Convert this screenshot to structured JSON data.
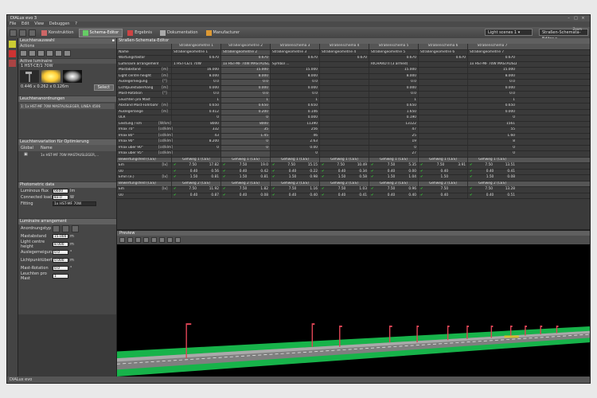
{
  "window": {
    "title": "DIALux evo 3",
    "buttons": [
      "–",
      "□",
      "×"
    ]
  },
  "menu": [
    "File",
    "Edit",
    "View",
    "Debuggen",
    "?"
  ],
  "tabs": [
    {
      "label": "Konstruktion"
    },
    {
      "label": "Schema-Editor",
      "active": true
    },
    {
      "label": "Ergebnis"
    },
    {
      "label": "Dokumentation"
    },
    {
      "label": "Manufacturer"
    }
  ],
  "toolbar": {
    "scene": "Light scenes 1",
    "editor": "Straßen-Schemata-Editor",
    "zoom": "Zoom"
  },
  "left": {
    "header": "Leuchtenauswahl",
    "actions": "Actions",
    "active": "Active luminaire",
    "lum_name": "1 HST-CE/1 70W",
    "dims": "0.446 x 0.262 x 0.126m",
    "select": "Select",
    "groups_header": "Leuchtenanordnungen",
    "group_item": "1: 1x HST-MF 70W MASTAUSLEGER, LINEA 4506",
    "opt_header": "Leuchtenvariation für Optimierung",
    "opt_cols": [
      "Global",
      "Name"
    ],
    "opt_row": "1x HST-MF 70W MASTAUSLEGER,...",
    "photo_header": "Photometric data",
    "flux_label": "Luminous flux",
    "flux": "6600",
    "flux_unit": "lm",
    "load_label": "Connected load",
    "load": "83.0",
    "load_unit": "W",
    "fitting_label": "Fitting",
    "fitting": "1x HST-MF 70W",
    "arr_header": "Luminaire arrangement",
    "arr_type": "Anordnungstyp",
    "mast_label": "Mastabstand",
    "mast": "15.000",
    "light_h_label": "Light centre height",
    "light_h": "8.000",
    "overhang_label": "Auslegerneigung",
    "overhang": "0.0",
    "lps_label": "Lichtpunktüberhang",
    "lps": "0.000",
    "rot_label": "Mast-Rotation",
    "rot": "0.0",
    "per_label": "Leuchten pro Mast",
    "per": "1"
  },
  "editor": {
    "header": "Straßen-Schemata-Editor",
    "status": "DIALux evo"
  },
  "grid": {
    "columns": [
      "Straßengeometrie 1",
      "Straßengeometrie 2",
      "Straßenschema 3",
      "Straßenschema 4",
      "Straßenschema 5",
      "Straßenschema 6",
      "Straßenschema 7"
    ],
    "rows": [
      {
        "n": "Name",
        "u": "",
        "v": [
          "Straßengeometrie 1",
          "Straßengeometrie 2",
          "Straßengeometrie 3",
          "Straßengeometrie 4",
          "Straßengeometrie 5",
          "Straßengeometrie 6",
          "Straßengeometrie 7"
        ],
        "left": true
      },
      {
        "n": "Wartungsfaktor",
        "u": "",
        "v": [
          "0.670",
          "0.670",
          "0.670",
          "0.670",
          "0.670",
          "0.670",
          "0.670"
        ]
      },
      {
        "n": "Luminaire arrangement 1",
        "u": "",
        "v": [
          "1 HST-CE/1 70W",
          "1x HST-MF 70W MASTAUSL...",
          "Symbol ...",
          "",
          "RICHARD II (3 armed)",
          "",
          "1x HST-MF 70W MASTAUSLE"
        ],
        "left": true
      },
      {
        "n": "Mastabstand",
        "u": "[m]",
        "v": [
          "16.000",
          "15.000",
          "15.000",
          "",
          "15.000",
          "",
          "15.000"
        ]
      },
      {
        "n": "Light centre height",
        "u": "[m]",
        "v": [
          "8.000",
          "8.000",
          "8.000",
          "",
          "8.000",
          "",
          "8.000"
        ]
      },
      {
        "n": "Auslegerneigung",
        "u": "[°]",
        "v": [
          "0.0",
          "0.0",
          "0.0",
          "",
          "0.0",
          "",
          "0.0"
        ]
      },
      {
        "n": "Lichtpunktüberhang",
        "u": "[m]",
        "v": [
          "0.000",
          "0.000",
          "0.000",
          "",
          "0.000",
          "",
          "0.000"
        ]
      },
      {
        "n": "Mast-Rotation",
        "u": "[°]",
        "v": [
          "0.0",
          "0.0",
          "0.0",
          "",
          "0.0",
          "",
          "0.0"
        ]
      },
      {
        "n": "Leuchten pro Mast",
        "u": "",
        "v": [
          "1",
          "1",
          "1",
          "",
          "1",
          "",
          "1"
        ]
      },
      {
        "n": "Abstand Mast-Fahrbahn",
        "u": "[m]",
        "v": [
          "0.650",
          "0.650",
          "0.650",
          "",
          "0.650",
          "",
          "0.650"
        ]
      },
      {
        "n": "Auslegerlänge",
        "u": "[m]",
        "v": [
          "0.412",
          "0.200",
          "0.146",
          "",
          "1.650",
          "",
          "0.000"
        ]
      },
      {
        "n": "ULR",
        "u": "",
        "v": [
          "0",
          "0",
          "0.000",
          "",
          "0.190",
          "",
          "0"
        ]
      },
      {
        "n": "Leistung / km",
        "u": "[W/km]",
        "v": [
          "8000",
          "8000",
          "11390",
          "",
          "13122",
          "",
          "1561"
        ]
      },
      {
        "n": "Imax 70°",
        "u": "[cd/klm]",
        "v": [
          "332",
          "35",
          "256",
          "",
          "47",
          "",
          "55"
        ]
      },
      {
        "n": "Imax 80°",
        "u": "[cd/klm]",
        "v": [
          "43",
          "1.45",
          "46",
          "",
          "25",
          "",
          "1.60"
        ]
      },
      {
        "n": "Imax 90°",
        "u": "[cd/klm]",
        "v": [
          "8.200",
          "0",
          "2.63",
          "",
          "19",
          "",
          "8"
        ]
      },
      {
        "n": "Imax über 90°",
        "u": "[cd/klm]",
        "v": [
          "0",
          "0",
          "0.00",
          "",
          "0",
          "",
          "0"
        ]
      },
      {
        "n": "Imax über 95°",
        "u": "[cd/klm]",
        "v": [
          "",
          "",
          "0",
          "",
          "27",
          "",
          "0"
        ]
      }
    ],
    "field1_label": "Bewertungsfeld (CES)",
    "field1": [
      "Gehweg 1 (CES)",
      "Gehweg 1 (CES)",
      "Gehweg 1 (CES)",
      "Gehweg 1 (CES)",
      "Gehweg 1 (CES)",
      "Gehweg 1 (CES)",
      "Gehweg 1 (CES)"
    ],
    "em_label": "Em",
    "em_unit": "[lx]",
    "em": [
      [
        "7.50",
        "17.82"
      ],
      [
        "7.50",
        "19.0"
      ],
      [
        "7.50",
        "15.15"
      ],
      [
        "7.50",
        "10.49"
      ],
      [
        "7.50",
        "5.35"
      ],
      [
        "7.50",
        "3.91"
      ],
      [
        "7.50",
        "13.51"
      ]
    ],
    "u0_label": "U0",
    "u0": [
      [
        "0.40",
        "0.56"
      ],
      [
        "0.40",
        "0.42"
      ],
      [
        "0.40",
        "0.22"
      ],
      [
        "0.40",
        "0.34"
      ],
      [
        "0.40",
        "0.00"
      ],
      [
        "0.40",
        ""
      ],
      [
        "0.40",
        "0.41"
      ]
    ],
    "emin_label": "Emin (e.)",
    "emin_unit": "[lx]",
    "emin": [
      [
        "1.50",
        "0.81"
      ],
      [
        "1.50",
        "0.81"
      ],
      [
        "1.50",
        "0.98"
      ],
      [
        "1.50",
        "0.58"
      ],
      [
        "1.50",
        "1.04"
      ],
      [
        "1.50",
        ""
      ],
      [
        "1.50",
        "0.08"
      ]
    ],
    "field2_label": "Bewertungsfeld (CES)",
    "field2": [
      "Gehweg 2 (CES)",
      "Gehweg 2 (CES)",
      "Gehweg 2 (CES)",
      "Gehweg 2 (CES)",
      "Gehweg 2 (CES)",
      "Gehweg 2 (CES)",
      "Gehweg 2 (CES)"
    ],
    "em2": [
      [
        "7.50",
        "11.92"
      ],
      [
        "7.50",
        "1.82"
      ],
      [
        "7.50",
        "1.16"
      ],
      [
        "7.50",
        "1.03"
      ],
      [
        "7.50",
        "0.96"
      ],
      [
        "7.50",
        ""
      ],
      [
        "7.50",
        "13.28"
      ]
    ],
    "u02": [
      [
        "0.40",
        "0.87"
      ],
      [
        "0.40",
        "0.08"
      ],
      [
        "0.40",
        "0.40"
      ],
      [
        "0.40",
        "0.41"
      ],
      [
        "0.40",
        "0.40"
      ],
      [
        "0.40",
        ""
      ],
      [
        "0.40",
        "0.51"
      ]
    ]
  },
  "preview": {
    "header": "Preview"
  }
}
